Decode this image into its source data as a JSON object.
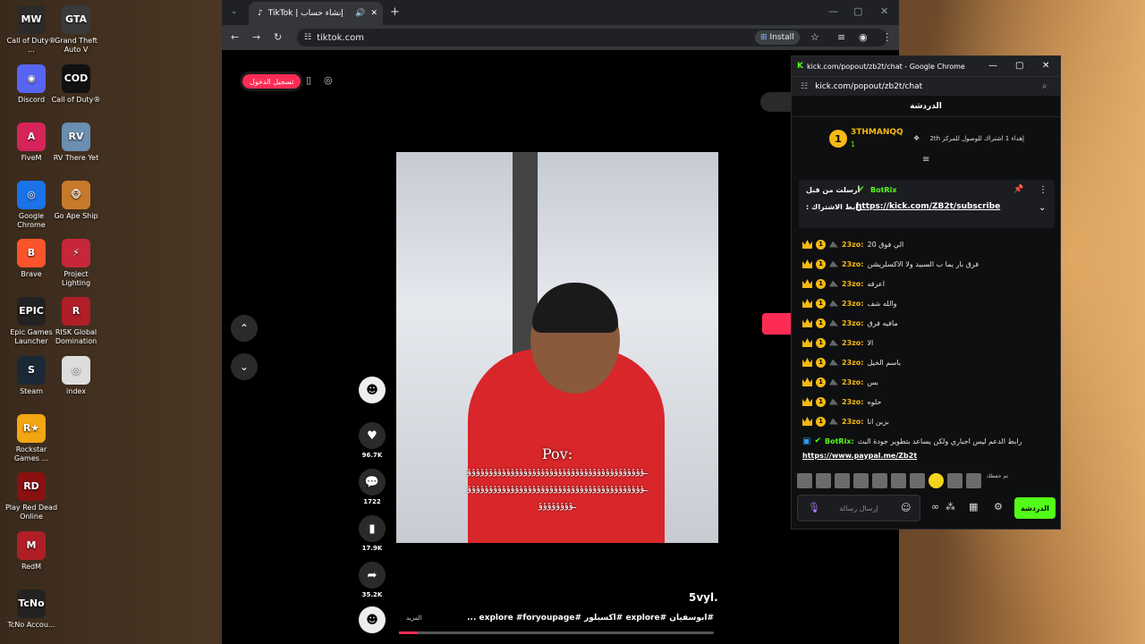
{
  "desktop": {
    "icons": [
      {
        "label": "Call of Duty® ...",
        "color": "#2b2b2b",
        "glyph": "MW"
      },
      {
        "label": "Grand Theft Auto V",
        "color": "#3a3a3a",
        "glyph": "GTA"
      },
      {
        "label": "Discord",
        "color": "#5865f2",
        "glyph": "◉"
      },
      {
        "label": "Call of Duty®",
        "color": "#111111",
        "glyph": "COD"
      },
      {
        "label": "FiveM",
        "color": "#d6245a",
        "glyph": "A"
      },
      {
        "label": "RV There Yet",
        "color": "#6a8fb0",
        "glyph": "RV"
      },
      {
        "label": "Google Chrome",
        "color": "#1a73e8",
        "glyph": "◎"
      },
      {
        "label": "Go Ape Ship",
        "color": "#c77a2a",
        "glyph": "🐵"
      },
      {
        "label": "Brave",
        "color": "#fb542b",
        "glyph": "B"
      },
      {
        "label": "Project Lighting",
        "color": "#c6283a",
        "glyph": "⚡"
      },
      {
        "label": "Epic Games Launcher",
        "color": "#222222",
        "glyph": "EPIC"
      },
      {
        "label": "RISK Global Domination",
        "color": "#b01e28",
        "glyph": "R"
      },
      {
        "label": "Steam",
        "color": "#1b2838",
        "glyph": "S"
      },
      {
        "label": "index",
        "color": "#dddddd",
        "glyph": "◎"
      },
      {
        "label": "Rockstar Games ...",
        "color": "#f3a612",
        "glyph": "R★"
      },
      {
        "label": "Play Red Dead Online",
        "color": "#8a1111",
        "glyph": "RD"
      },
      {
        "label": "RedM",
        "color": "#b01e28",
        "glyph": "M"
      },
      {
        "label": "TcNo Accou...",
        "color": "#222222",
        "glyph": "TcNo"
      }
    ]
  },
  "tiktok_window": {
    "tab_title": "TikTok | إنشاء حساب",
    "new_tab": "+",
    "url": "tiktok.com",
    "install_label": "Install",
    "login_label": "تسجيل الدخول",
    "video": {
      "overlay_title": "Pov:",
      "wave_line_1": "ـؤؤؤؤؤؤؤؤؤؤؤؤؤؤؤؤؤؤؤؤؤؤؤؤؤؤؤؤؤؤؤؤؤؤؤؤؤؤؤؤؤ",
      "wave_line_2": "ـؤؤؤؤؤؤؤؤؤؤؤؤؤؤؤؤؤؤؤؤؤؤؤؤؤؤؤؤؤؤؤؤؤؤؤؤؤؤؤؤؤ",
      "wave_line_3": "ـؤؤؤؤؤؤؤؤ",
      "progress": 0.06
    },
    "actions": {
      "likes": "96.7K",
      "comments": "1722",
      "saves": "17.9K",
      "shares": "35.2K"
    },
    "author_handle": "5vyl.",
    "caption": "#ابوسفيان #explore #اكسبلور #explore #foryoupage ...",
    "more_label": "المزيد"
  },
  "kick_window": {
    "window_title": "kick.com/popout/zb2t/chat - Google Chrome",
    "url": "kick.com/popout/zb2t/chat",
    "header": "الدردشة",
    "top_gifter": {
      "rank": "1",
      "name": "3THMANQQ",
      "count": "1",
      "info": "إهداء 1 اشتراك للوصول للمركز 2th"
    },
    "pinned": {
      "label": "أرسلت من قبل",
      "author": "BotRix",
      "text_prefix": "رابط الاشتراك :",
      "link": "https://kick.com/ZB2t/subscribe"
    },
    "messages": [
      {
        "user": "23zo:",
        "text": "الي فوق 20"
      },
      {
        "user": "23zo:",
        "text": "فرق بار يما ب السبيد ولا الاكسلريشن"
      },
      {
        "user": "23zo:",
        "text": "اعرفه"
      },
      {
        "user": "23zo:",
        "text": "والله شف"
      },
      {
        "user": "23zo:",
        "text": "مافيه فرق"
      },
      {
        "user": "23zo:",
        "text": "الا"
      },
      {
        "user": "23zo:",
        "text": "باسم الخيل"
      },
      {
        "user": "23zo:",
        "text": "بس"
      },
      {
        "user": "23zo:",
        "text": "حلوه"
      },
      {
        "user": "23zo:",
        "text": "بزين انا"
      }
    ],
    "bot_message": {
      "user": "BotRix:",
      "text": "رابط الدعم ليس اجباري ولكن يساعد بتطوير جودة البث",
      "link": "https://www.paypal.me/Zb2t"
    },
    "emote_more_label": "تم حفظك",
    "input_placeholder": "إرسال رسالة",
    "send_label": "الدردشة"
  },
  "colors": {
    "tiktok_red": "#fe2c55",
    "kick_green": "#53fc18",
    "gold": "#f5b914"
  }
}
